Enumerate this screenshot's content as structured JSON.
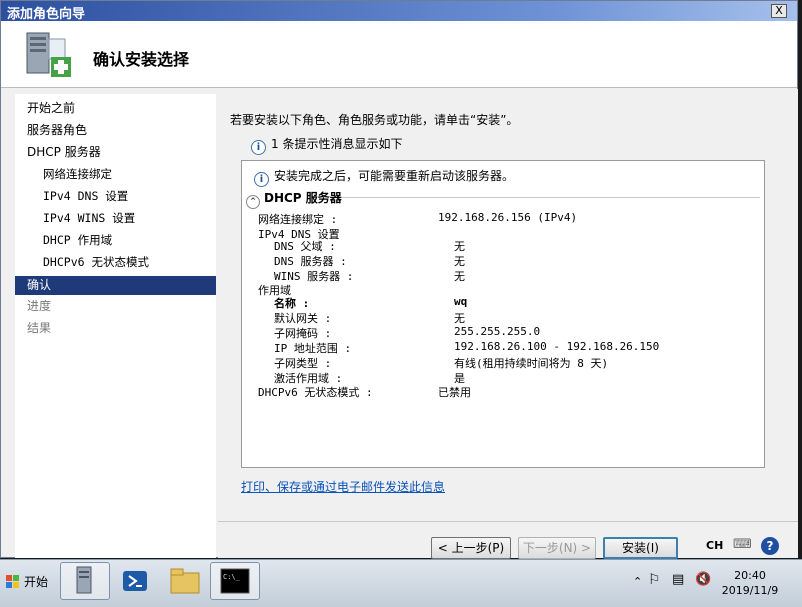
{
  "window": {
    "title": "添加角色向导",
    "close_label": "X",
    "heading": "确认安装选择"
  },
  "nav": {
    "items": [
      {
        "label": "开始之前"
      },
      {
        "label": "服务器角色"
      },
      {
        "label": "DHCP 服务器"
      },
      {
        "label": "网络连接绑定"
      },
      {
        "label": "IPv4 DNS 设置"
      },
      {
        "label": "IPv4 WINS 设置"
      },
      {
        "label": "DHCP 作用域"
      },
      {
        "label": "DHCPv6 无状态模式"
      },
      {
        "label": "确认"
      },
      {
        "label": "进度"
      },
      {
        "label": "结果"
      }
    ]
  },
  "content": {
    "intro": "若要安装以下角色、角色服务或功能，请单击“安装”。",
    "info_count": "1 条提示性消息显示如下",
    "notice": "安装完成之后，可能需要重新启动该服务器。",
    "section_title": "DHCP 服务器",
    "rows": [
      {
        "key": "网络连接绑定 :",
        "value": "192.168.26.156 (IPv4)"
      },
      {
        "key": "IPv4 DNS 设置",
        "value": ""
      },
      {
        "key": "DNS 父域 :",
        "value": "无"
      },
      {
        "key": "DNS 服务器 :",
        "value": "无"
      },
      {
        "key": "WINS 服务器 :",
        "value": "无"
      },
      {
        "key": "作用域",
        "value": ""
      },
      {
        "key": "名称 :",
        "value": "wq"
      },
      {
        "key": "默认网关 :",
        "value": "无"
      },
      {
        "key": "子网掩码 :",
        "value": "255.255.255.0"
      },
      {
        "key": "IP 地址范围 :",
        "value": "192.168.26.100 - 192.168.26.150"
      },
      {
        "key": "子网类型 :",
        "value": "有线(租用持续时间将为 8 天)"
      },
      {
        "key": "激活作用域 :",
        "value": "是"
      },
      {
        "key": "DHCPv6 无状态模式 :",
        "value": "已禁用"
      }
    ],
    "link": "打印、保存或通过电子邮件发送此信息"
  },
  "buttons": {
    "prev": "< 上一步(P)",
    "next": "下一步(N) >",
    "install": "安装(I)"
  },
  "taskbar": {
    "start": "开始",
    "lang": "CH",
    "time": "20:40",
    "date": "2019/11/9"
  },
  "colors": {
    "nav_selected": "#1f3a78",
    "link": "#0b52b8",
    "titlebar": "#2c4fa0"
  }
}
